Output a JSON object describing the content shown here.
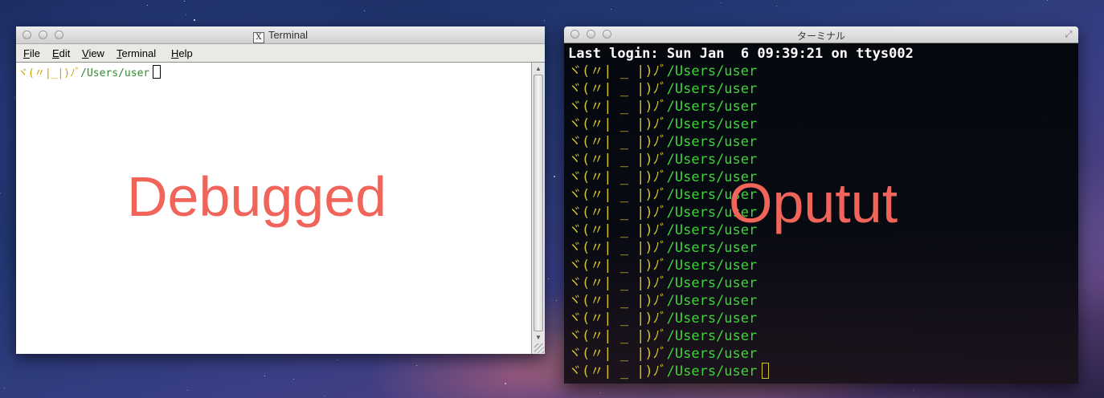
{
  "xterm": {
    "title": "Terminal",
    "title_icon": "X",
    "menu": [
      {
        "label": "File",
        "accel": "F",
        "rest": "ile"
      },
      {
        "label": "Edit",
        "accel": "E",
        "rest": "dit"
      },
      {
        "label": "View",
        "accel": "V",
        "rest": "iew"
      },
      {
        "label": "Terminal",
        "accel": "T",
        "rest": "erminal"
      },
      {
        "label": "Help",
        "accel": "H",
        "rest": "elp"
      }
    ],
    "prompt": "ヾ(〃|_|)ﾉﾞ",
    "path": "/Users/user"
  },
  "mac_terminal": {
    "title": "ターミナル",
    "last_login": "Last login: Sun Jan  6 09:39:21 on ttys002",
    "prompt": "ヾ(〃| _ |)ﾉﾞ",
    "path": "/Users/user",
    "prompt_line_count": 18
  },
  "labels": {
    "left": "Debugged",
    "right": "Oputut"
  },
  "colors": {
    "label": "#f0645a",
    "prompt_yellow": "#d4c22a",
    "path_green": "#3fd43a"
  }
}
